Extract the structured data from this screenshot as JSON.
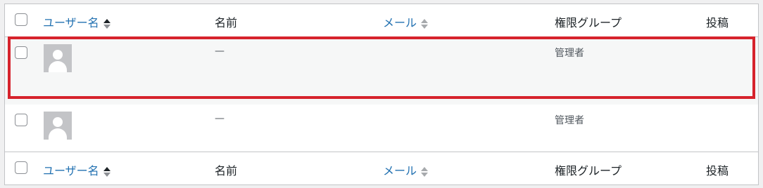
{
  "columns": {
    "username": "ユーザー名",
    "name": "名前",
    "email": "メール",
    "role": "権限グループ",
    "posts": "投稿"
  },
  "rows": [
    {
      "name": "—",
      "role": "管理者",
      "highlighted": true
    },
    {
      "name": "—",
      "role": "管理者",
      "highlighted": false
    }
  ],
  "colors": {
    "link": "#2271b1",
    "highlight_border": "#d6232c",
    "row_hover_bg": "#f6f7f7"
  },
  "icons": {
    "sort_username": "sort-asc-icon",
    "sort_email": "sort-both-icon",
    "avatar": "default-avatar-icon"
  }
}
